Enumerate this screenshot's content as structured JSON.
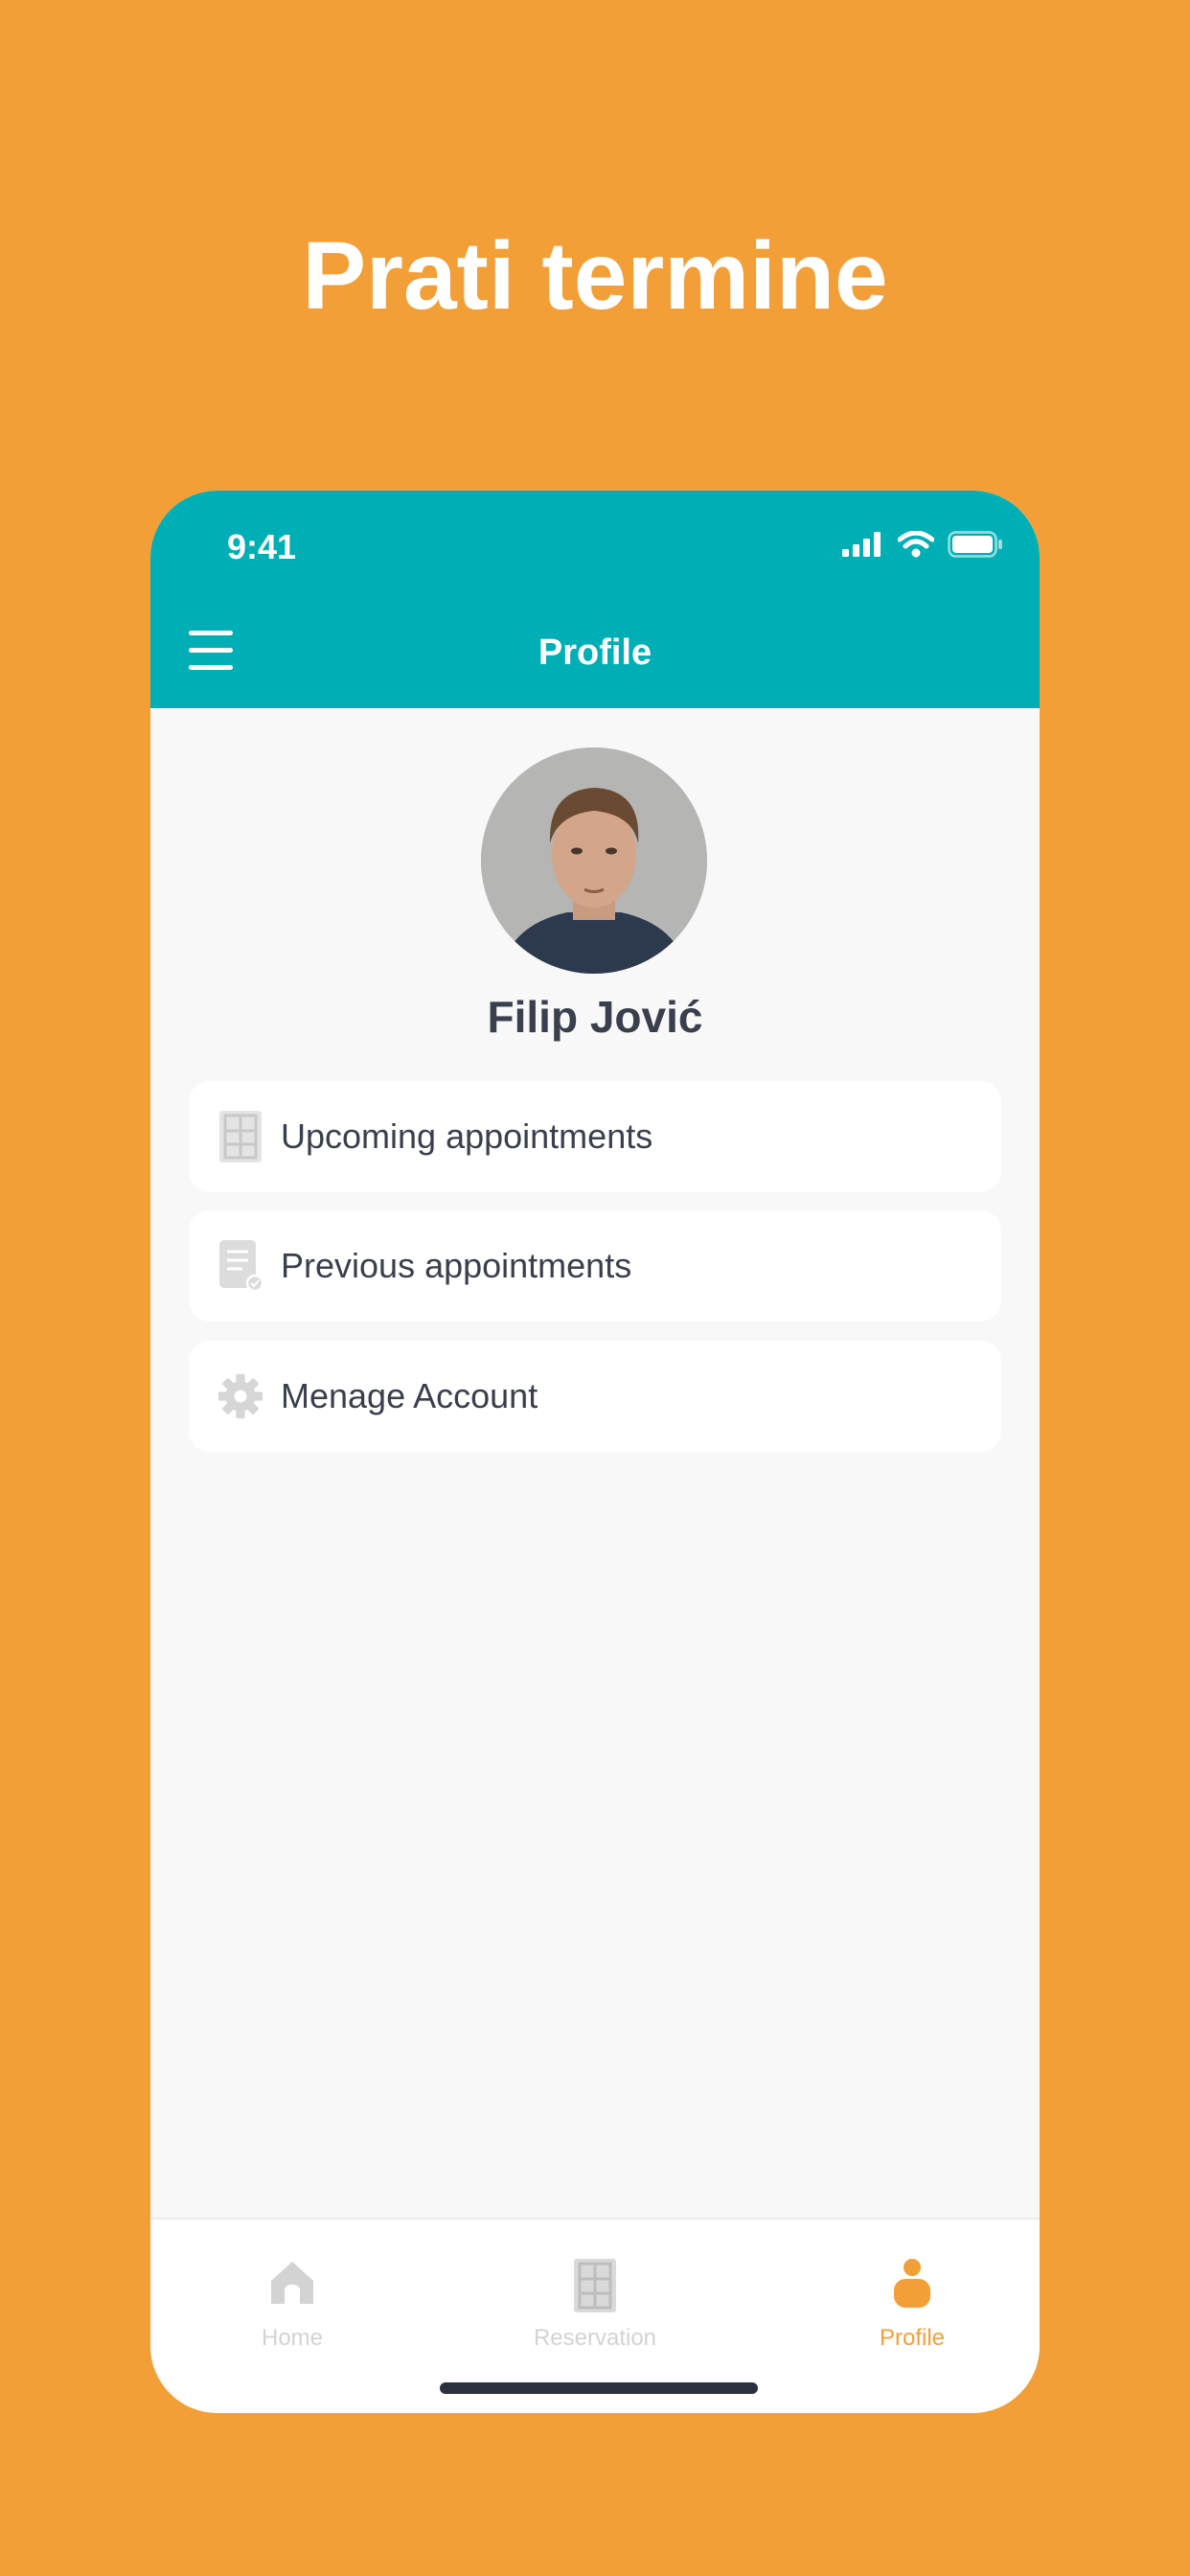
{
  "headline": "Prati termine",
  "status_bar": {
    "time": "9:41"
  },
  "header": {
    "title": "Profile"
  },
  "profile": {
    "name": "Filip Jović"
  },
  "menu": {
    "items": [
      {
        "label": "Upcoming appointments",
        "icon": "calendar-icon"
      },
      {
        "label": "Previous appointments",
        "icon": "document-icon"
      },
      {
        "label": "Menage Account",
        "icon": "gear-icon"
      }
    ]
  },
  "tabbar": {
    "tabs": [
      {
        "label": "Home",
        "icon": "home-icon",
        "active": false
      },
      {
        "label": "Reservation",
        "icon": "calendar-icon",
        "active": false
      },
      {
        "label": "Profile",
        "icon": "person-icon",
        "active": true
      }
    ]
  },
  "colors": {
    "background": "#F29F38",
    "header": "#00AFB6",
    "active_tab": "#F29F38",
    "inactive_tab": "#D3D3D3",
    "text_dark": "#3A3F4D"
  }
}
